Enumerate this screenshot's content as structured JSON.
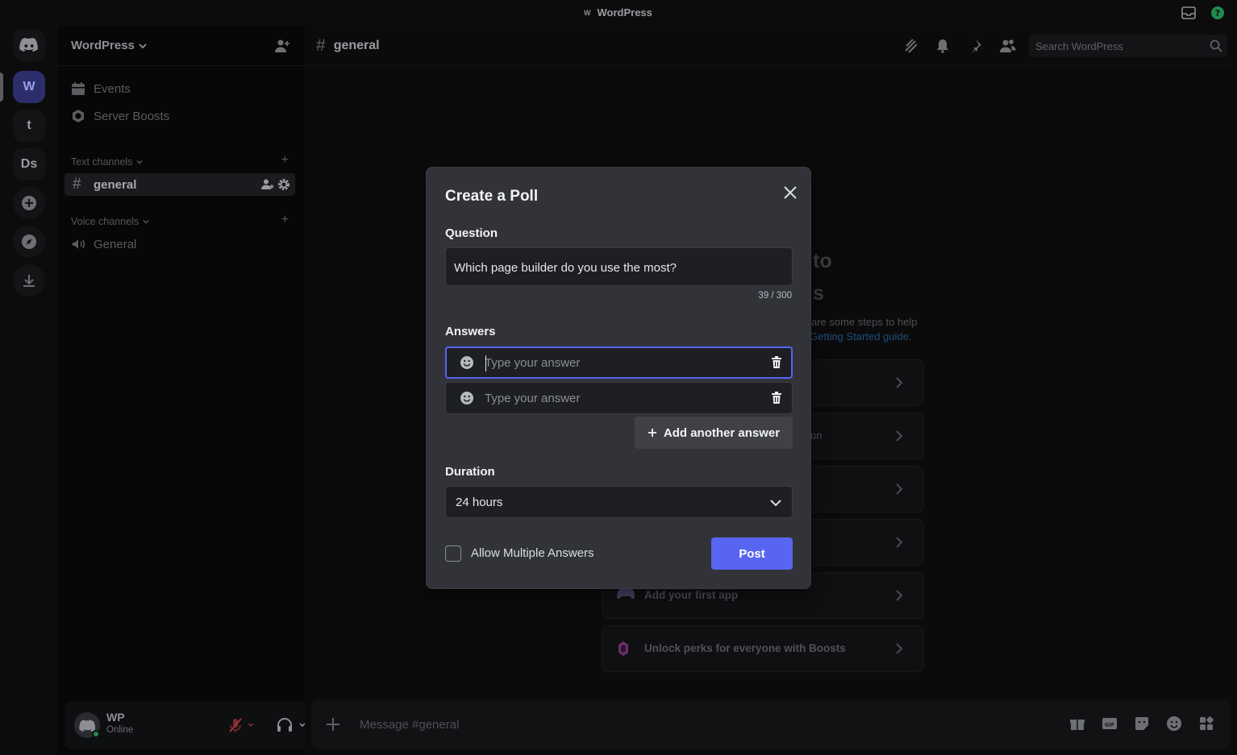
{
  "window": {
    "title": "WordPress",
    "logo_letter": "W"
  },
  "servers": [
    {
      "label": "W",
      "active": true
    },
    {
      "label": "t"
    },
    {
      "label": "Ds"
    }
  ],
  "sidebar": {
    "guild_name": "WordPress",
    "links": [
      {
        "label": "Events",
        "icon": "calendar-icon"
      },
      {
        "label": "Server Boosts",
        "icon": "boost-icon"
      }
    ],
    "text_category": "Text channels",
    "active_channel": "general",
    "voice_category": "Voice channels",
    "voice_channel": "General"
  },
  "user": {
    "name": "WP",
    "status": "Online"
  },
  "channel_header": {
    "name": "general",
    "search_placeholder": "Search WordPress"
  },
  "background": {
    "peek_1": "to",
    "peek_2": "s",
    "sub_text": "are some steps to help",
    "link_text": "Getting Started guide.",
    "step_peek": "on",
    "steps": [
      {
        "label": "Add your first app",
        "icon": "gamepad-icon"
      },
      {
        "label": "Unlock perks for everyone with Boosts",
        "icon": "boost-gem-icon"
      }
    ]
  },
  "composer": {
    "placeholder": "Message #general"
  },
  "poll_modal": {
    "title": "Create a Poll",
    "question_label": "Question",
    "question_value": "Which page builder do you use the most?",
    "question_counter": "39 / 300",
    "answers_label": "Answers",
    "answers": [
      {
        "placeholder": "Type your answer",
        "value": "",
        "focused": true
      },
      {
        "placeholder": "Type your answer",
        "value": "",
        "focused": false
      }
    ],
    "add_answer_label": "Add another answer",
    "duration_label": "Duration",
    "duration_value": "24 hours",
    "allow_multiple_label": "Allow Multiple Answers",
    "allow_multiple_checked": false,
    "post_label": "Post"
  },
  "colors": {
    "accent": "#5865f2",
    "modal_bg": "#313338",
    "input_bg": "#1e1f22",
    "online": "#1f8b4c"
  }
}
